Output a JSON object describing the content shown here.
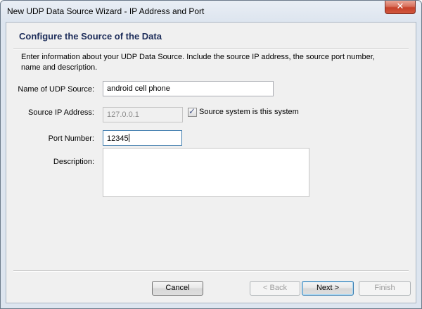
{
  "window": {
    "title": "New UDP Data Source Wizard - IP Address and Port",
    "close_icon": "close-x"
  },
  "header": {
    "title": "Configure the Source of the Data"
  },
  "instructions": "Enter information about your UDP Data Source. Include the source IP address, the source port number, name and description.",
  "form": {
    "name": {
      "label": "Name of UDP Source:",
      "value": "android cell phone"
    },
    "ip": {
      "label": "Source IP Address:",
      "value": "127.0.0.1",
      "enabled": false
    },
    "same_system": {
      "label": "Source system is this system",
      "checked": true
    },
    "port": {
      "label": "Port Number:",
      "value": "12345"
    },
    "description": {
      "label": "Description:",
      "value": ""
    }
  },
  "buttons": {
    "cancel": "Cancel",
    "back": "< Back",
    "next": "Next >",
    "finish": "Finish"
  }
}
